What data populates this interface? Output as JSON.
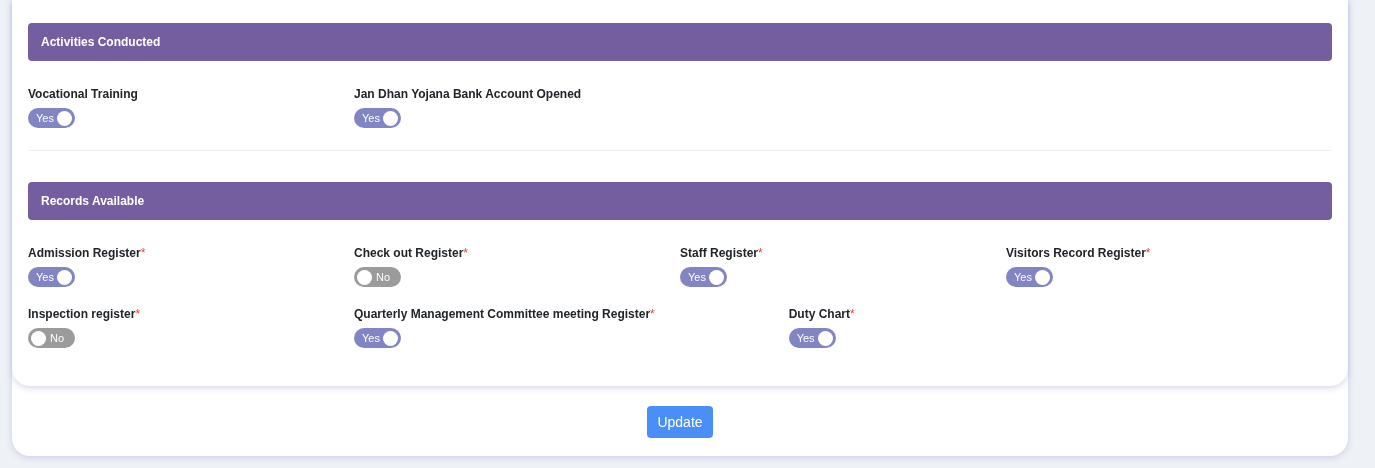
{
  "sections": [
    {
      "title": "Activities Conducted",
      "fields": [
        {
          "label": "Vocational Training",
          "on": true,
          "value": "Yes"
        },
        {
          "label": "Jan Dhan Yojana Bank Account Opened",
          "on": true,
          "value": "Yes"
        }
      ]
    },
    {
      "title": "Records Available",
      "fields": [
        {
          "label": "Admission Register",
          "mark": "*",
          "on": true,
          "value": "Yes"
        },
        {
          "label": "Check out Register",
          "mark": "*",
          "on": false,
          "value": "No"
        },
        {
          "label": "Staff Register",
          "mark": "*",
          "on": true,
          "value": "Yes"
        },
        {
          "label": "Visitors Record Register",
          "mark": "*",
          "on": true,
          "value": "Yes"
        },
        {
          "label": "Inspection register",
          "mark": "*",
          "on": false,
          "value": "No"
        },
        {
          "label": "Quarterly Management Committee meeting Register",
          "mark": "*",
          "on": true,
          "value": "Yes"
        },
        {
          "label": "Duty Chart",
          "mark": "*",
          "on": true,
          "value": "Yes"
        }
      ]
    }
  ],
  "submit": "Update"
}
